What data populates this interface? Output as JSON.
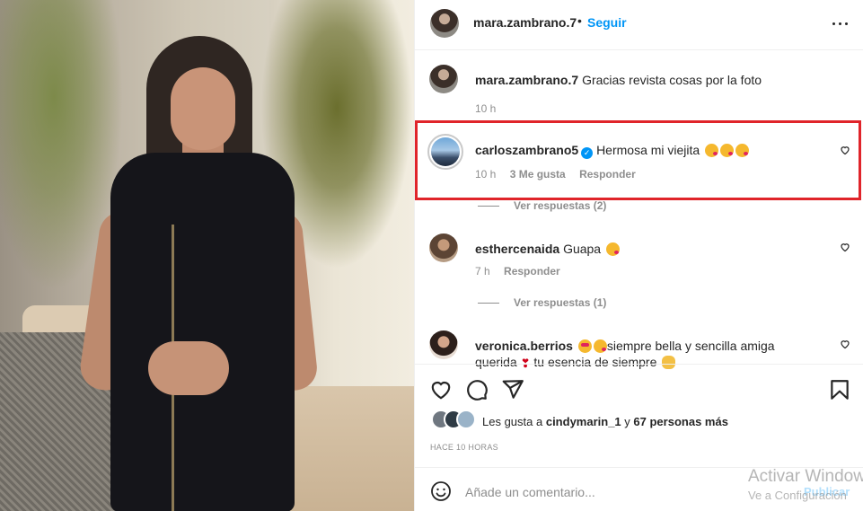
{
  "post": {
    "username": "mara.zambrano.7",
    "follow_label": "Seguir",
    "separator": "•"
  },
  "comments": [
    {
      "username": "mara.zambrano.7",
      "text": "Gracias revista cosas por la foto",
      "time": "10 h"
    },
    {
      "username": "carloszambrano5",
      "verified": true,
      "text": "Hermosa mi viejita",
      "emojis": [
        "kissing-heart-emoji",
        "kissing-heart-emoji",
        "kissing-heart-emoji"
      ],
      "time": "10 h",
      "likes": "3 Me gusta",
      "reply_label": "Responder",
      "view_replies": "Ver respuestas (2)"
    },
    {
      "username": "esthercenaida",
      "text": "Guapa",
      "emojis": [
        "kissing-heart-emoji"
      ],
      "time": "7 h",
      "reply_label": "Responder",
      "view_replies": "Ver respuestas (1)"
    },
    {
      "username": "veronica.berrios",
      "text_part1": "siempre bella y sencilla amiga querida",
      "text_part2": "tu esencia de siempre",
      "emojis": [
        "heart-eyes-emoji",
        "kissing-heart-emoji",
        "red-heart-emoji",
        "clapping-hands-emoji"
      ]
    }
  ],
  "actions": {
    "icons": [
      "heart-icon",
      "comment-icon",
      "share-icon",
      "bookmark-icon"
    ]
  },
  "likes": {
    "prefix": "Les gusta a",
    "first_user": "cindymarin_1",
    "connector": "y",
    "others": "67 personas más"
  },
  "timestamp": "HACE 10 HORAS",
  "add_comment": {
    "placeholder": "Añade un comentario...",
    "publish_label": "Publicar"
  },
  "watermark": {
    "line1": "Activar Windows",
    "line2": "Ve a Configuración"
  },
  "colors": {
    "accent": "#0095f6",
    "highlight_border": "#e0242a",
    "text": "#262626",
    "secondary_text": "#8e8e8e"
  }
}
